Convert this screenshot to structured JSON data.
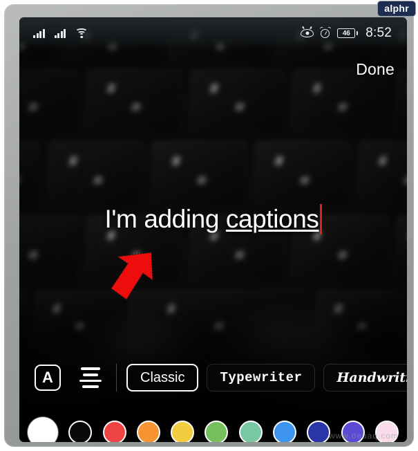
{
  "badge": {
    "label": "alphr"
  },
  "watermark": {
    "text": "www.deuaq.com"
  },
  "status_bar": {
    "signal_1_icon": "cellular-signal-icon",
    "signal_2_icon": "cellular-signal-icon",
    "wifi_icon": "wifi-icon",
    "eye_icon": "eye-comfort-icon",
    "alarm_icon": "alarm-clock-icon",
    "battery_level": "46",
    "battery_icon": "battery-icon",
    "time": "8:52"
  },
  "header": {
    "done_label": "Done"
  },
  "caption": {
    "text_plain": "I'm adding ",
    "text_underlined": "captions",
    "cursor_color": "#e02020"
  },
  "annotation": {
    "arrow_name": "red-pointer-arrow",
    "arrow_color": "#ee0d0d"
  },
  "toolbar": {
    "caps_label": "A",
    "caps_icon": "capitalization-icon",
    "align_icon": "text-alignment-icon",
    "fonts": [
      {
        "label": "Classic",
        "selected": true
      },
      {
        "label": "Typewriter",
        "selected": false
      },
      {
        "label": "Handwriting",
        "selected": false
      },
      {
        "label": "",
        "selected": false
      }
    ]
  },
  "colors": {
    "swatches": [
      {
        "name": "white",
        "hex": "#ffffff",
        "selected": true
      },
      {
        "name": "black",
        "hex": "#0a0a0a",
        "selected": false
      },
      {
        "name": "red",
        "hex": "#ef4444",
        "selected": false
      },
      {
        "name": "orange",
        "hex": "#f79432",
        "selected": false
      },
      {
        "name": "yellow",
        "hex": "#f2cc41",
        "selected": false
      },
      {
        "name": "green",
        "hex": "#76bf5e",
        "selected": false
      },
      {
        "name": "mint",
        "hex": "#79c8a4",
        "selected": false
      },
      {
        "name": "light-blue",
        "hex": "#3d94ef",
        "selected": false
      },
      {
        "name": "dark-blue",
        "hex": "#2a35a8",
        "selected": false
      },
      {
        "name": "purple",
        "hex": "#5b4ad4",
        "selected": false
      },
      {
        "name": "pink",
        "hex": "#fadceb",
        "selected": false
      }
    ]
  }
}
